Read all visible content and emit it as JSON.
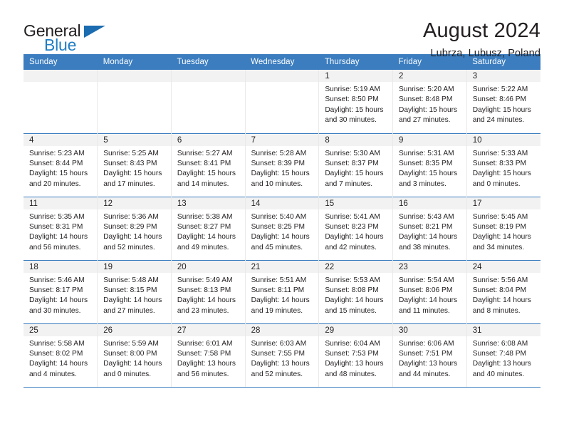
{
  "logo": {
    "word_top": "General",
    "word_bottom": "Blue",
    "accent_color": "#1b6cb0"
  },
  "header": {
    "month_title": "August 2024",
    "location": "Lubrza, Lubusz, Poland"
  },
  "calendar": {
    "header_bg": "#3b7dbf",
    "daynum_bg": "#f2f2f2",
    "weekday_headers": [
      "Sunday",
      "Monday",
      "Tuesday",
      "Wednesday",
      "Thursday",
      "Friday",
      "Saturday"
    ],
    "weeks": [
      [
        {
          "day": "",
          "sunrise": "",
          "sunset": "",
          "daylight_line1": "",
          "daylight_line2": ""
        },
        {
          "day": "",
          "sunrise": "",
          "sunset": "",
          "daylight_line1": "",
          "daylight_line2": ""
        },
        {
          "day": "",
          "sunrise": "",
          "sunset": "",
          "daylight_line1": "",
          "daylight_line2": ""
        },
        {
          "day": "",
          "sunrise": "",
          "sunset": "",
          "daylight_line1": "",
          "daylight_line2": ""
        },
        {
          "day": "1",
          "sunrise": "Sunrise: 5:19 AM",
          "sunset": "Sunset: 8:50 PM",
          "daylight_line1": "Daylight: 15 hours",
          "daylight_line2": "and 30 minutes."
        },
        {
          "day": "2",
          "sunrise": "Sunrise: 5:20 AM",
          "sunset": "Sunset: 8:48 PM",
          "daylight_line1": "Daylight: 15 hours",
          "daylight_line2": "and 27 minutes."
        },
        {
          "day": "3",
          "sunrise": "Sunrise: 5:22 AM",
          "sunset": "Sunset: 8:46 PM",
          "daylight_line1": "Daylight: 15 hours",
          "daylight_line2": "and 24 minutes."
        }
      ],
      [
        {
          "day": "4",
          "sunrise": "Sunrise: 5:23 AM",
          "sunset": "Sunset: 8:44 PM",
          "daylight_line1": "Daylight: 15 hours",
          "daylight_line2": "and 20 minutes."
        },
        {
          "day": "5",
          "sunrise": "Sunrise: 5:25 AM",
          "sunset": "Sunset: 8:43 PM",
          "daylight_line1": "Daylight: 15 hours",
          "daylight_line2": "and 17 minutes."
        },
        {
          "day": "6",
          "sunrise": "Sunrise: 5:27 AM",
          "sunset": "Sunset: 8:41 PM",
          "daylight_line1": "Daylight: 15 hours",
          "daylight_line2": "and 14 minutes."
        },
        {
          "day": "7",
          "sunrise": "Sunrise: 5:28 AM",
          "sunset": "Sunset: 8:39 PM",
          "daylight_line1": "Daylight: 15 hours",
          "daylight_line2": "and 10 minutes."
        },
        {
          "day": "8",
          "sunrise": "Sunrise: 5:30 AM",
          "sunset": "Sunset: 8:37 PM",
          "daylight_line1": "Daylight: 15 hours",
          "daylight_line2": "and 7 minutes."
        },
        {
          "day": "9",
          "sunrise": "Sunrise: 5:31 AM",
          "sunset": "Sunset: 8:35 PM",
          "daylight_line1": "Daylight: 15 hours",
          "daylight_line2": "and 3 minutes."
        },
        {
          "day": "10",
          "sunrise": "Sunrise: 5:33 AM",
          "sunset": "Sunset: 8:33 PM",
          "daylight_line1": "Daylight: 15 hours",
          "daylight_line2": "and 0 minutes."
        }
      ],
      [
        {
          "day": "11",
          "sunrise": "Sunrise: 5:35 AM",
          "sunset": "Sunset: 8:31 PM",
          "daylight_line1": "Daylight: 14 hours",
          "daylight_line2": "and 56 minutes."
        },
        {
          "day": "12",
          "sunrise": "Sunrise: 5:36 AM",
          "sunset": "Sunset: 8:29 PM",
          "daylight_line1": "Daylight: 14 hours",
          "daylight_line2": "and 52 minutes."
        },
        {
          "day": "13",
          "sunrise": "Sunrise: 5:38 AM",
          "sunset": "Sunset: 8:27 PM",
          "daylight_line1": "Daylight: 14 hours",
          "daylight_line2": "and 49 minutes."
        },
        {
          "day": "14",
          "sunrise": "Sunrise: 5:40 AM",
          "sunset": "Sunset: 8:25 PM",
          "daylight_line1": "Daylight: 14 hours",
          "daylight_line2": "and 45 minutes."
        },
        {
          "day": "15",
          "sunrise": "Sunrise: 5:41 AM",
          "sunset": "Sunset: 8:23 PM",
          "daylight_line1": "Daylight: 14 hours",
          "daylight_line2": "and 42 minutes."
        },
        {
          "day": "16",
          "sunrise": "Sunrise: 5:43 AM",
          "sunset": "Sunset: 8:21 PM",
          "daylight_line1": "Daylight: 14 hours",
          "daylight_line2": "and 38 minutes."
        },
        {
          "day": "17",
          "sunrise": "Sunrise: 5:45 AM",
          "sunset": "Sunset: 8:19 PM",
          "daylight_line1": "Daylight: 14 hours",
          "daylight_line2": "and 34 minutes."
        }
      ],
      [
        {
          "day": "18",
          "sunrise": "Sunrise: 5:46 AM",
          "sunset": "Sunset: 8:17 PM",
          "daylight_line1": "Daylight: 14 hours",
          "daylight_line2": "and 30 minutes."
        },
        {
          "day": "19",
          "sunrise": "Sunrise: 5:48 AM",
          "sunset": "Sunset: 8:15 PM",
          "daylight_line1": "Daylight: 14 hours",
          "daylight_line2": "and 27 minutes."
        },
        {
          "day": "20",
          "sunrise": "Sunrise: 5:49 AM",
          "sunset": "Sunset: 8:13 PM",
          "daylight_line1": "Daylight: 14 hours",
          "daylight_line2": "and 23 minutes."
        },
        {
          "day": "21",
          "sunrise": "Sunrise: 5:51 AM",
          "sunset": "Sunset: 8:11 PM",
          "daylight_line1": "Daylight: 14 hours",
          "daylight_line2": "and 19 minutes."
        },
        {
          "day": "22",
          "sunrise": "Sunrise: 5:53 AM",
          "sunset": "Sunset: 8:08 PM",
          "daylight_line1": "Daylight: 14 hours",
          "daylight_line2": "and 15 minutes."
        },
        {
          "day": "23",
          "sunrise": "Sunrise: 5:54 AM",
          "sunset": "Sunset: 8:06 PM",
          "daylight_line1": "Daylight: 14 hours",
          "daylight_line2": "and 11 minutes."
        },
        {
          "day": "24",
          "sunrise": "Sunrise: 5:56 AM",
          "sunset": "Sunset: 8:04 PM",
          "daylight_line1": "Daylight: 14 hours",
          "daylight_line2": "and 8 minutes."
        }
      ],
      [
        {
          "day": "25",
          "sunrise": "Sunrise: 5:58 AM",
          "sunset": "Sunset: 8:02 PM",
          "daylight_line1": "Daylight: 14 hours",
          "daylight_line2": "and 4 minutes."
        },
        {
          "day": "26",
          "sunrise": "Sunrise: 5:59 AM",
          "sunset": "Sunset: 8:00 PM",
          "daylight_line1": "Daylight: 14 hours",
          "daylight_line2": "and 0 minutes."
        },
        {
          "day": "27",
          "sunrise": "Sunrise: 6:01 AM",
          "sunset": "Sunset: 7:58 PM",
          "daylight_line1": "Daylight: 13 hours",
          "daylight_line2": "and 56 minutes."
        },
        {
          "day": "28",
          "sunrise": "Sunrise: 6:03 AM",
          "sunset": "Sunset: 7:55 PM",
          "daylight_line1": "Daylight: 13 hours",
          "daylight_line2": "and 52 minutes."
        },
        {
          "day": "29",
          "sunrise": "Sunrise: 6:04 AM",
          "sunset": "Sunset: 7:53 PM",
          "daylight_line1": "Daylight: 13 hours",
          "daylight_line2": "and 48 minutes."
        },
        {
          "day": "30",
          "sunrise": "Sunrise: 6:06 AM",
          "sunset": "Sunset: 7:51 PM",
          "daylight_line1": "Daylight: 13 hours",
          "daylight_line2": "and 44 minutes."
        },
        {
          "day": "31",
          "sunrise": "Sunrise: 6:08 AM",
          "sunset": "Sunset: 7:48 PM",
          "daylight_line1": "Daylight: 13 hours",
          "daylight_line2": "and 40 minutes."
        }
      ]
    ]
  }
}
